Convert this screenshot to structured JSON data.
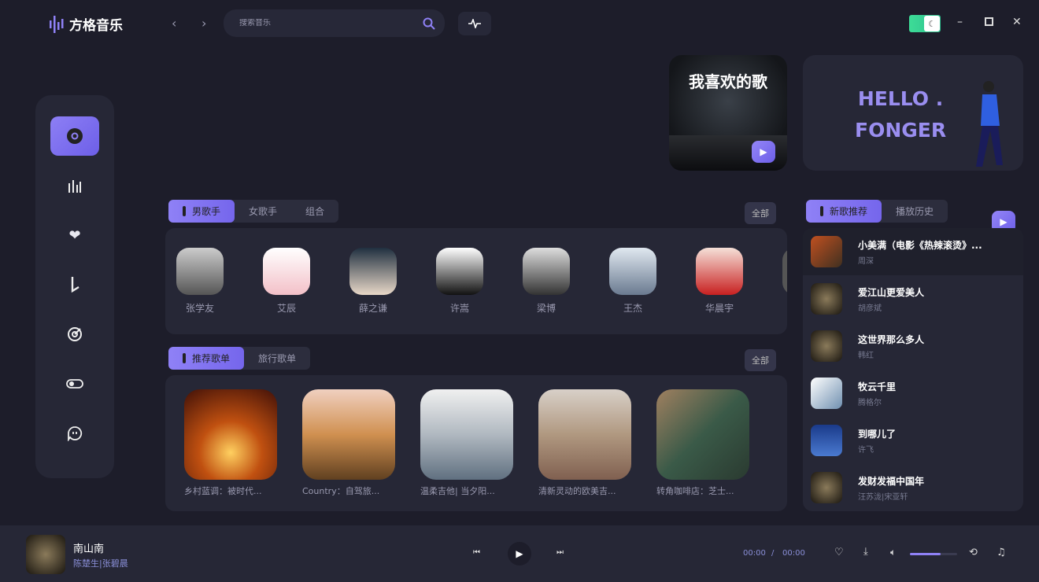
{
  "app": {
    "title": "方格音乐"
  },
  "search": {
    "placeholder": "搜索音乐"
  },
  "nav": {
    "back": "‹",
    "forward": "›"
  },
  "sidebar": {
    "items": [
      {
        "icon": "disc-icon",
        "active": true
      },
      {
        "icon": "chart-icon"
      },
      {
        "icon": "heart-icon"
      },
      {
        "icon": "note-icon"
      },
      {
        "icon": "radar-icon"
      },
      {
        "icon": "toggle-icon"
      },
      {
        "icon": "chat-icon"
      }
    ]
  },
  "banner": {
    "title": "我喜欢的歌",
    "hello": "HELLO .\nFONGER"
  },
  "singers": {
    "tabs": [
      "男歌手",
      "女歌手",
      "组合"
    ],
    "all": "全部",
    "items": [
      "张学友",
      "艾辰",
      "薛之谦",
      "许嵩",
      "梁博",
      "王杰",
      "华晨宇"
    ]
  },
  "playlists": {
    "tabs": [
      "推荐歌单",
      "旅行歌单"
    ],
    "all": "全部",
    "items": [
      "乡村蓝调：被时代...",
      "Country：自驾旅...",
      "温柔吉他| 当夕阳...",
      "清新灵动的欧美吉...",
      "转角咖啡店：芝士..."
    ]
  },
  "songs": {
    "tabs": [
      "新歌推荐",
      "播放历史"
    ],
    "items": [
      {
        "title": "小美满（电影《热辣滚烫》...",
        "artist": "周深"
      },
      {
        "title": "爱江山更爱美人",
        "artist": "胡彦斌"
      },
      {
        "title": "这世界那么多人",
        "artist": "韩红"
      },
      {
        "title": "牧云千里",
        "artist": "腾格尔"
      },
      {
        "title": "到哪儿了",
        "artist": "许飞"
      },
      {
        "title": "发财发福中国年",
        "artist": "汪苏泷|宋亚轩"
      }
    ]
  },
  "player": {
    "title": "南山南",
    "artist": "陈楚生|张碧晨",
    "current": "00:00",
    "sep": "/",
    "duration": "00:00",
    "volume": 0.65
  },
  "colors": {
    "accent": "#7b6cf0",
    "bg": "#1d1d2a",
    "panel": "#262736"
  }
}
